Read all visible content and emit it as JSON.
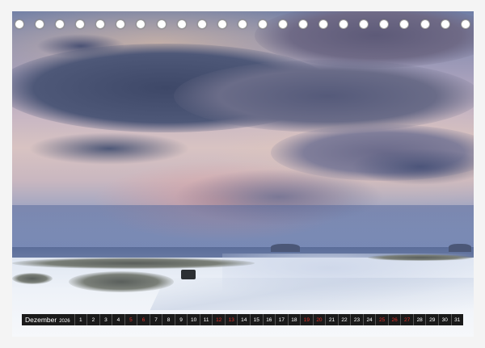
{
  "calendar": {
    "month": "Dezember",
    "year": "2026",
    "days": [
      "1",
      "2",
      "3",
      "4",
      "5",
      "6",
      "7",
      "8",
      "9",
      "10",
      "11",
      "12",
      "13",
      "14",
      "15",
      "16",
      "17",
      "18",
      "19",
      "20",
      "21",
      "22",
      "23",
      "24",
      "25",
      "26",
      "27",
      "28",
      "29",
      "30",
      "31"
    ],
    "red_days": [
      "5",
      "6",
      "12",
      "13",
      "19",
      "20",
      "25",
      "26",
      "27"
    ]
  },
  "binding": {
    "ring_count": 23
  },
  "colors": {
    "weekend_red": "#e0322a",
    "bar_black": "#1a1a1a"
  }
}
